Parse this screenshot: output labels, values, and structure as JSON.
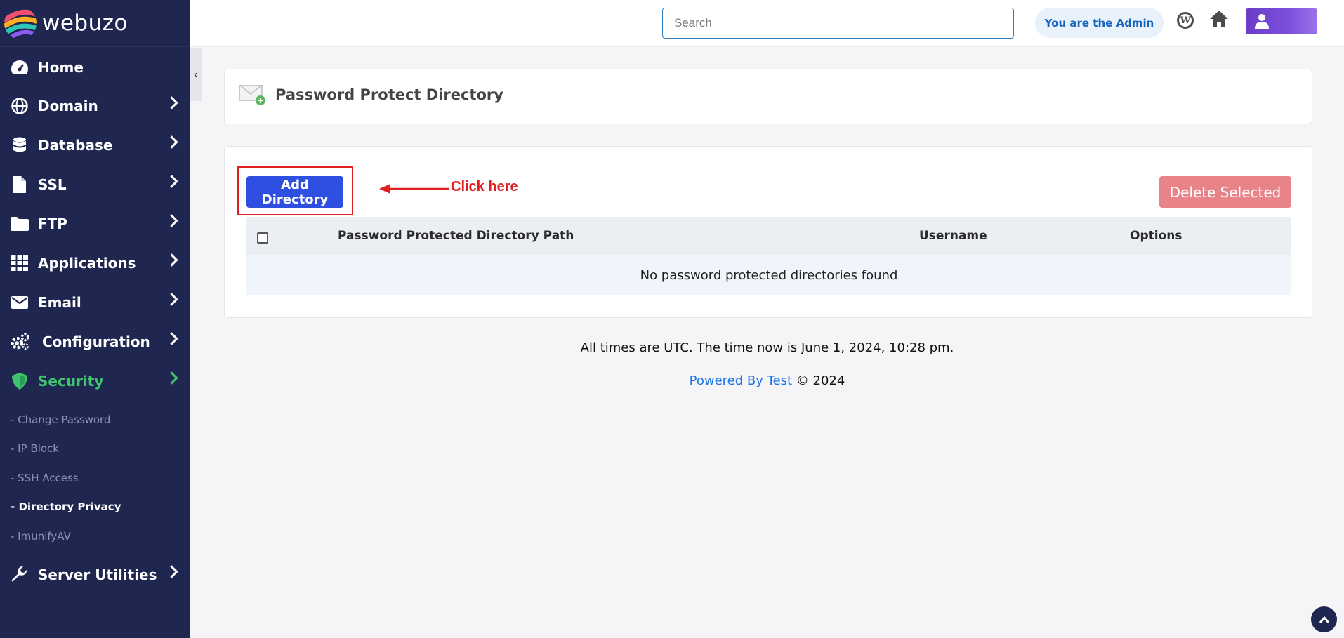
{
  "brand": {
    "name": "webuzo"
  },
  "sidebar": {
    "items": [
      {
        "label": "Home",
        "icon": "dashboard-icon"
      },
      {
        "label": "Domain",
        "icon": "globe-icon"
      },
      {
        "label": "Database",
        "icon": "database-icon"
      },
      {
        "label": "SSL",
        "icon": "file-icon"
      },
      {
        "label": "FTP",
        "icon": "folder-icon"
      },
      {
        "label": "Applications",
        "icon": "grid-icon"
      },
      {
        "label": "Email",
        "icon": "envelope-icon"
      },
      {
        "label": "Configuration",
        "icon": "gears-icon"
      },
      {
        "label": "Security",
        "icon": "shield-icon",
        "active": true
      },
      {
        "label": "Server Utilities",
        "icon": "wrench-icon"
      }
    ],
    "security_sub": [
      "- Change Password",
      "- IP Block",
      "- SSH Access",
      "- Directory Privacy",
      "- ImunifyAV"
    ],
    "current_sub": "- Directory Privacy"
  },
  "header": {
    "search_placeholder": "Search",
    "admin_badge": "You are the Admin"
  },
  "page": {
    "title": "Password Protect Directory",
    "add_button": "Add Directory",
    "annotation": "Click here",
    "delete_button": "Delete Selected",
    "table": {
      "columns": [
        "Password Protected Directory Path",
        "Username",
        "Options"
      ],
      "empty_message": "No password protected directories found"
    }
  },
  "footer": {
    "time_text": "All times are UTC. The time now is June 1, 2024, 10:28 pm.",
    "powered_link": "Powered By Test",
    "copyright": "© 2024"
  },
  "colors": {
    "sidebar_bg": "#1f2650",
    "active_green": "#3ec46d",
    "primary_blue": "#2e4fe0",
    "danger_light": "#e8838a",
    "annotation_red": "#e02020"
  }
}
